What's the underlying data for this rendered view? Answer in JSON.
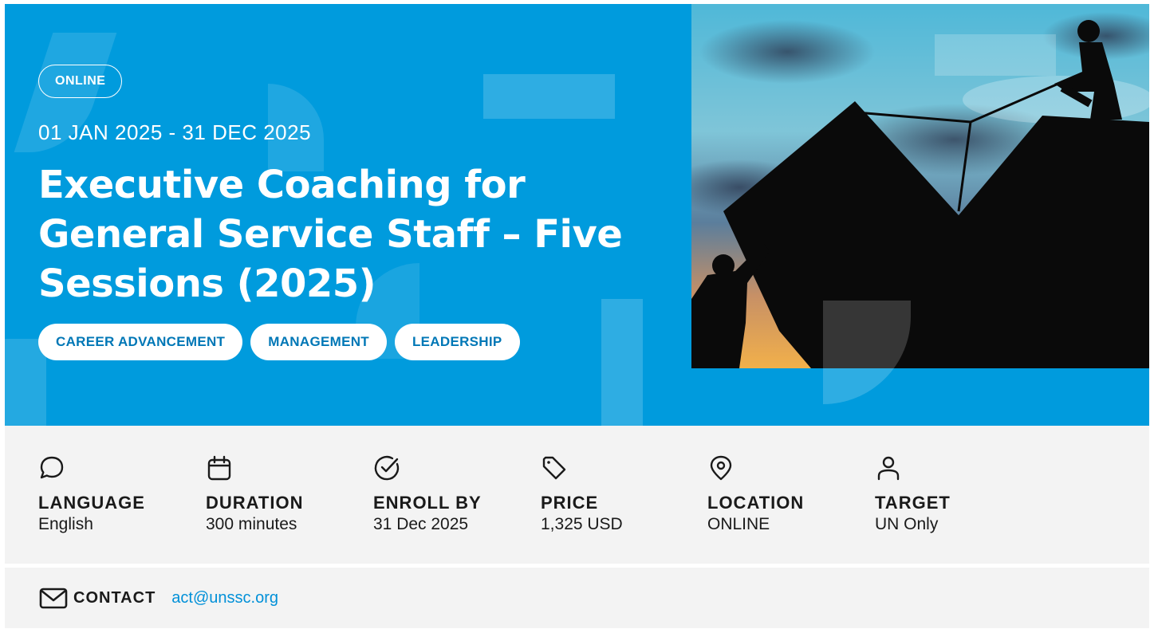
{
  "hero": {
    "badge": "ONLINE",
    "dates": "01 JAN 2025 - 31 DEC 2025",
    "title": "Executive Coaching for General Service Staff – Five Sessions (2025)",
    "tags": [
      "CAREER ADVANCEMENT",
      "MANAGEMENT",
      "LEADERSHIP"
    ],
    "image_icon": "teamwork-silhouette-image",
    "colors": {
      "background": "#009bdd",
      "tag_text": "#0077b6"
    }
  },
  "info": [
    {
      "icon": "chat-bubble-icon",
      "label": "LANGUAGE",
      "value": "English"
    },
    {
      "icon": "calendar-icon",
      "label": "DURATION",
      "value": "300 minutes"
    },
    {
      "icon": "check-circle-icon",
      "label": "ENROLL BY",
      "value": "31 Dec 2025"
    },
    {
      "icon": "price-tag-icon",
      "label": "PRICE",
      "value": "1,325 USD"
    },
    {
      "icon": "location-pin-icon",
      "label": "LOCATION",
      "value": "ONLINE"
    },
    {
      "icon": "user-icon",
      "label": "TARGET",
      "value": "UN Only"
    }
  ],
  "contact": {
    "icon": "mail-icon",
    "label": "CONTACT",
    "email": "act@unssc.org",
    "email_color": "#0090d8"
  }
}
